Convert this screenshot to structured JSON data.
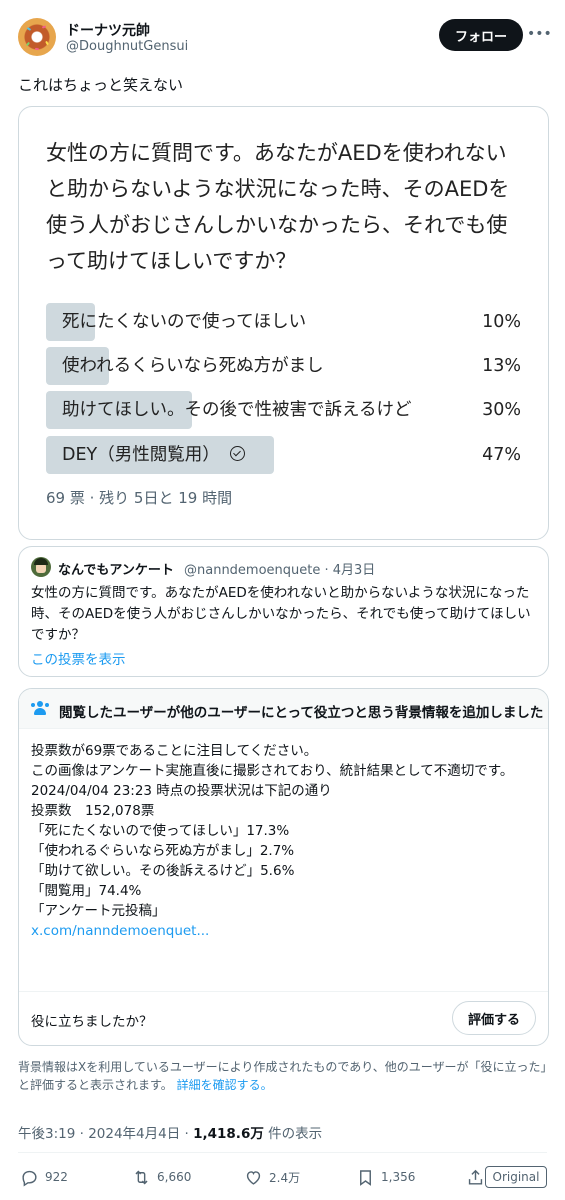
{
  "author": {
    "name": "ドーナツ元帥",
    "handle": "@DoughnutGensui",
    "follow_label": "フォロー",
    "more_icon": "more-icon"
  },
  "tweet_text": "これはちょっと笑えない",
  "poll_image": {
    "question": "女性の方に質問です。あなたがAEDを使われないと助からないような状況になった時、そのAEDを使う人がおじさんしかいなかったら、それでも使って助けてほしいですか？",
    "options": [
      {
        "label": "死にたくないので使ってほしい",
        "percent": "10%",
        "value": 0.1
      },
      {
        "label": "使われるくらいなら死ぬ方がまし",
        "percent": "13%",
        "value": 0.13
      },
      {
        "label": "助けてほしい。その後で性被害で訴えるけど",
        "percent": "30%",
        "value": 0.3
      },
      {
        "label": "DEY（男性閲覧用）",
        "percent": "47%",
        "value": 0.47,
        "selected": true
      }
    ],
    "meta": "69 票 · 残り 5日と 19 時間"
  },
  "quote": {
    "name": "なんでもアンケート",
    "handle_date": "@nanndemoenquete · 4月3日",
    "text": "女性の方に質問です。あなたがAEDを使われないと助からないような状況になった時、そのAEDを使う人がおじさんしかいなかったら、それでも使って助けてほしいですか？",
    "link": "この投票を表示"
  },
  "note": {
    "title": "閲覧したユーザーが他のユーザーにとって役立つと思う背景情報を追加しました",
    "lines": [
      "投票数が69票であることに注目してください。",
      "",
      "この画像はアンケート実施直後に撮影されており、統計結果として不適切です。",
      "",
      "2024/04/04 23:23 時点の投票状況は下記の通り",
      "投票数　152,078票",
      "「死にたくないので使ってほしい」17.3%",
      "「使われるぐらいなら死ぬ方がまし」2.7%",
      "「助けて欲しい。その後訴えるけど」5.6%",
      "「閲覧用」74.4%",
      "",
      "「アンケート元投稿」"
    ],
    "link": "x.com/nanndemoenquet...",
    "helpful_question": "役に立ちましたか？",
    "rate_label": "評価する"
  },
  "disclaimer": {
    "text": "背景情報はXを利用しているユーザーにより作成されたものであり、他のユーザーが「役に立った」と評価すると表示されます。",
    "link": "詳細を確認する。"
  },
  "meta": {
    "time_date": "午後3:19 · 2024年4月4日 · ",
    "views": "1,418.6万",
    "views_suffix": " 件の表示"
  },
  "actions": {
    "replies": "922",
    "reposts": "6,660",
    "likes": "2.4万",
    "bookmarks": "1,356",
    "original_label": "Original"
  }
}
